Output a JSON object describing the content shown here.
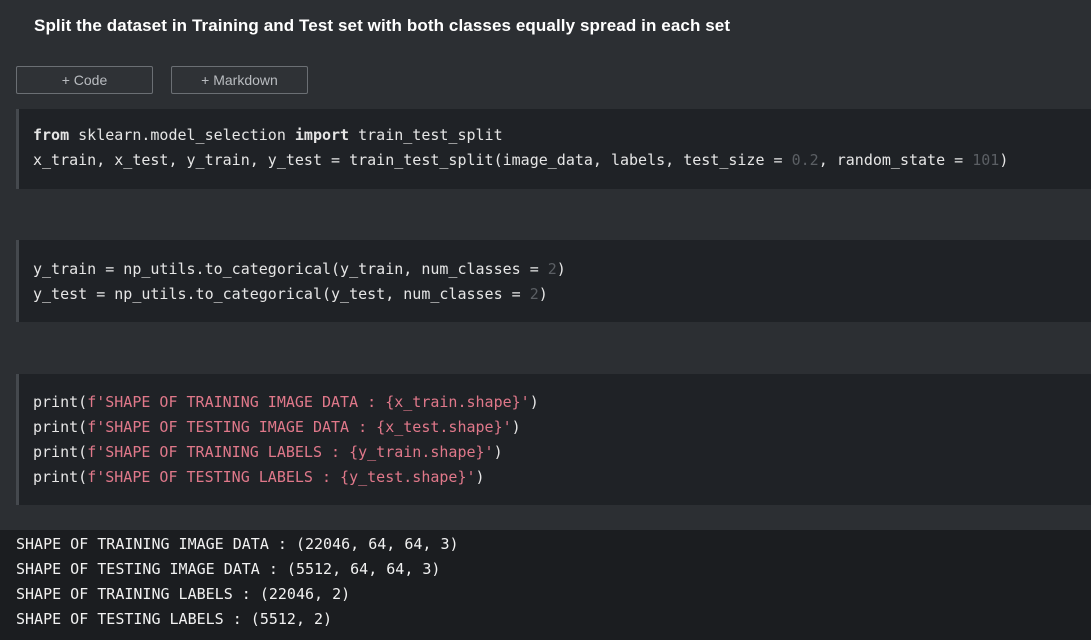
{
  "heading": "Split the dataset in Training and Test set with both classes equally spread in each set",
  "buttons": {
    "code": "+ Code",
    "markdown": "+ Markdown"
  },
  "cell1": {
    "l1_kw1": "from",
    "l1_mid": " sklearn.model_selection ",
    "l1_kw2": "import",
    "l1_end": " train_test_split",
    "l2_a": "x_train, x_test, y_train, y_test = train_test_split(image_data, labels, test_size = ",
    "l2_num1": "0.2",
    "l2_b": ", random_state = ",
    "l2_num2": "101",
    "l2_c": ")"
  },
  "cell2": {
    "l1_a": "y_train = np_utils.to_categorical(y_train, num_classes = ",
    "l1_num": "2",
    "l1_c": ")",
    "l2_a": "y_test = np_utils.to_categorical(y_test, num_classes = ",
    "l2_num": "2",
    "l2_c": ")"
  },
  "cell3": {
    "l1_a": "print(",
    "l1_s": "f'SHAPE OF TRAINING IMAGE DATA : {x_train.shape}'",
    "l1_c": ")",
    "l2_a": "print(",
    "l2_s": "f'SHAPE OF TESTING IMAGE DATA : {x_test.shape}'",
    "l2_c": ")",
    "l3_a": "print(",
    "l3_s": "f'SHAPE OF TRAINING LABELS : {y_train.shape}'",
    "l3_c": ")",
    "l4_a": "print(",
    "l4_s": "f'SHAPE OF TESTING LABELS : {y_test.shape}'",
    "l4_c": ")"
  },
  "output": [
    "SHAPE OF TRAINING IMAGE DATA : (22046, 64, 64, 3)",
    "SHAPE OF TESTING IMAGE DATA : (5512, 64, 64, 3)",
    "SHAPE OF TRAINING LABELS : (22046, 2)",
    "SHAPE OF TESTING LABELS : (5512, 2)"
  ],
  "colors": {
    "background": "#2c2f33",
    "cell": "#1f2226",
    "string": "#e0788a",
    "number": "#5b5f64"
  }
}
